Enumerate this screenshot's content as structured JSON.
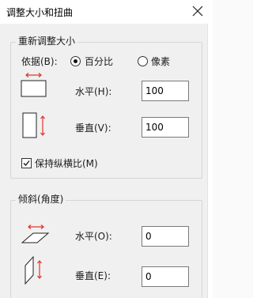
{
  "window": {
    "title": "调整大小和扭曲"
  },
  "resize": {
    "legend": "重新调整大小",
    "by_label": "依据(B):",
    "percent_label": "百分比",
    "pixels_label": "像素",
    "selected": "percent",
    "horizontal_label": "水平(H):",
    "horizontal_value": "100",
    "vertical_label": "垂直(V):",
    "vertical_value": "100",
    "keep_ratio_label": "保持纵横比(M)",
    "keep_ratio_checked": true
  },
  "skew": {
    "legend": "倾斜(角度)",
    "horizontal_label": "水平(O):",
    "horizontal_value": "0",
    "vertical_label": "垂直(E):",
    "vertical_value": "0"
  },
  "colors": {
    "arrow": "#e0342c",
    "accent": "#0078d7"
  },
  "icons": [
    "close-icon",
    "resize-horizontal-icon",
    "resize-vertical-icon",
    "skew-horizontal-icon",
    "skew-vertical-icon",
    "checkmark-icon"
  ]
}
